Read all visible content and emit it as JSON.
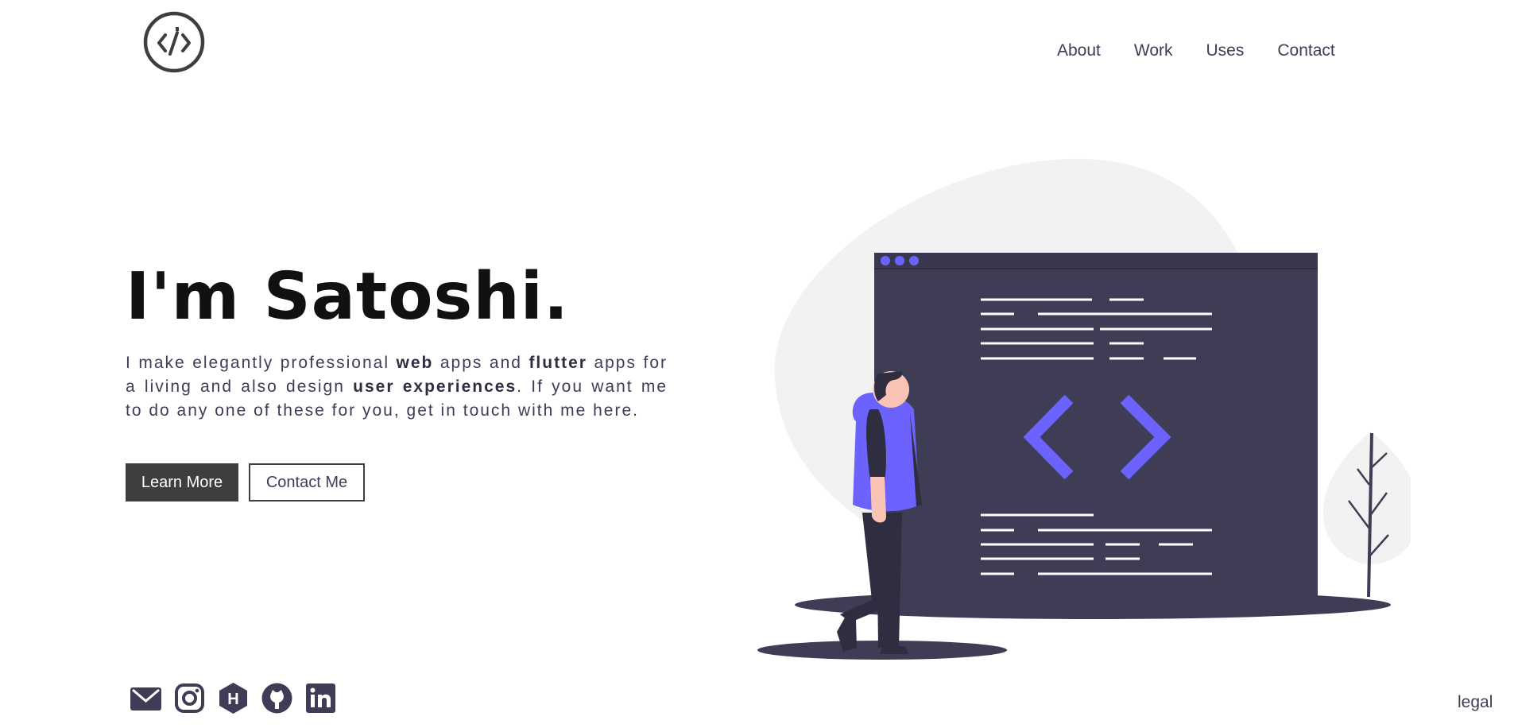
{
  "header": {
    "logo": "code-logo-icon",
    "nav": [
      {
        "label": "About"
      },
      {
        "label": "Work"
      },
      {
        "label": "Uses"
      },
      {
        "label": "Contact"
      }
    ]
  },
  "hero": {
    "title": "I'm Satoshi.",
    "text_parts": {
      "p1": "I make elegantly professional ",
      "b1": "web",
      "p2": " apps and ",
      "b2": "flutter",
      "p3": " apps for a living and also design ",
      "b3": "user experiences",
      "p4": ". If you want me to do any one of these for you, get in touch with me here."
    },
    "primary_button": "Learn More",
    "secondary_button": "Contact Me"
  },
  "footer": {
    "socials": [
      "mail-icon",
      "instagram-icon",
      "hashnode-icon",
      "github-icon",
      "linkedin-icon"
    ],
    "legal": "legal"
  },
  "colors": {
    "accent": "#6c63ff",
    "dark": "#3f3d56",
    "button": "#3f3d40",
    "blob": "#f2f2f2"
  }
}
